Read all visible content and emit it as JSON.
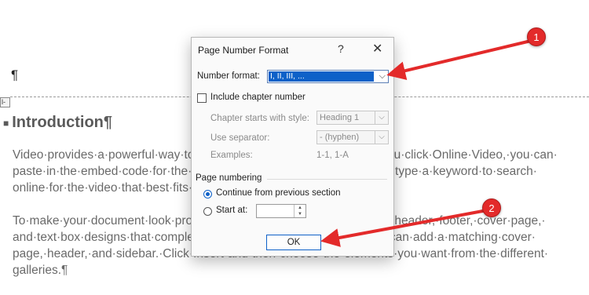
{
  "document": {
    "pilcrow": "¶",
    "header_tab": "l-",
    "heading": "Introduction¶",
    "para1": [
      "Video·provides·a·powerful·way·to·help·you·prove·your·point.·When·you·click·Online·Video,·you·can·",
      "paste·in·the·embed·code·for·the·video·you·want·to·add.·You·can·also·type·a·keyword·to·search·",
      "online·for·the·video·that·best·fits·your·document.¶"
    ],
    "para2": [
      "To·make·your·document·look·professionally·produced,·Word·provides·header,·footer,·cover·page,·",
      "and·text·box·designs·that·complement·each·other.·For·example,·you·can·add·a·matching·cover·",
      "page,·header,·and·sidebar.·Click·Insert·and·then·choose·the·elements·you·want·from·the·different·",
      "galleries.¶"
    ]
  },
  "dialog": {
    "title": "Page Number Format",
    "help": "?",
    "close": "✕",
    "number_format_label": "Number format:",
    "number_format_value": "I, II, III, ...",
    "include_chapter_label": "Include chapter number",
    "chapter_style_label": "Chapter starts with style:",
    "chapter_style_value": "Heading 1",
    "separator_label": "Use separator:",
    "separator_value": "-   (hyphen)",
    "examples_label": "Examples:",
    "examples_value": "1-1, 1-A",
    "page_numbering_label": "Page numbering",
    "continue_label": "Continue from previous section",
    "start_at_label": "Start at:",
    "start_at_value": "",
    "ok_label": "OK"
  },
  "callouts": [
    "1",
    "2"
  ],
  "colors": {
    "accent": "#0e61c8",
    "callout": "#e32a2a"
  }
}
